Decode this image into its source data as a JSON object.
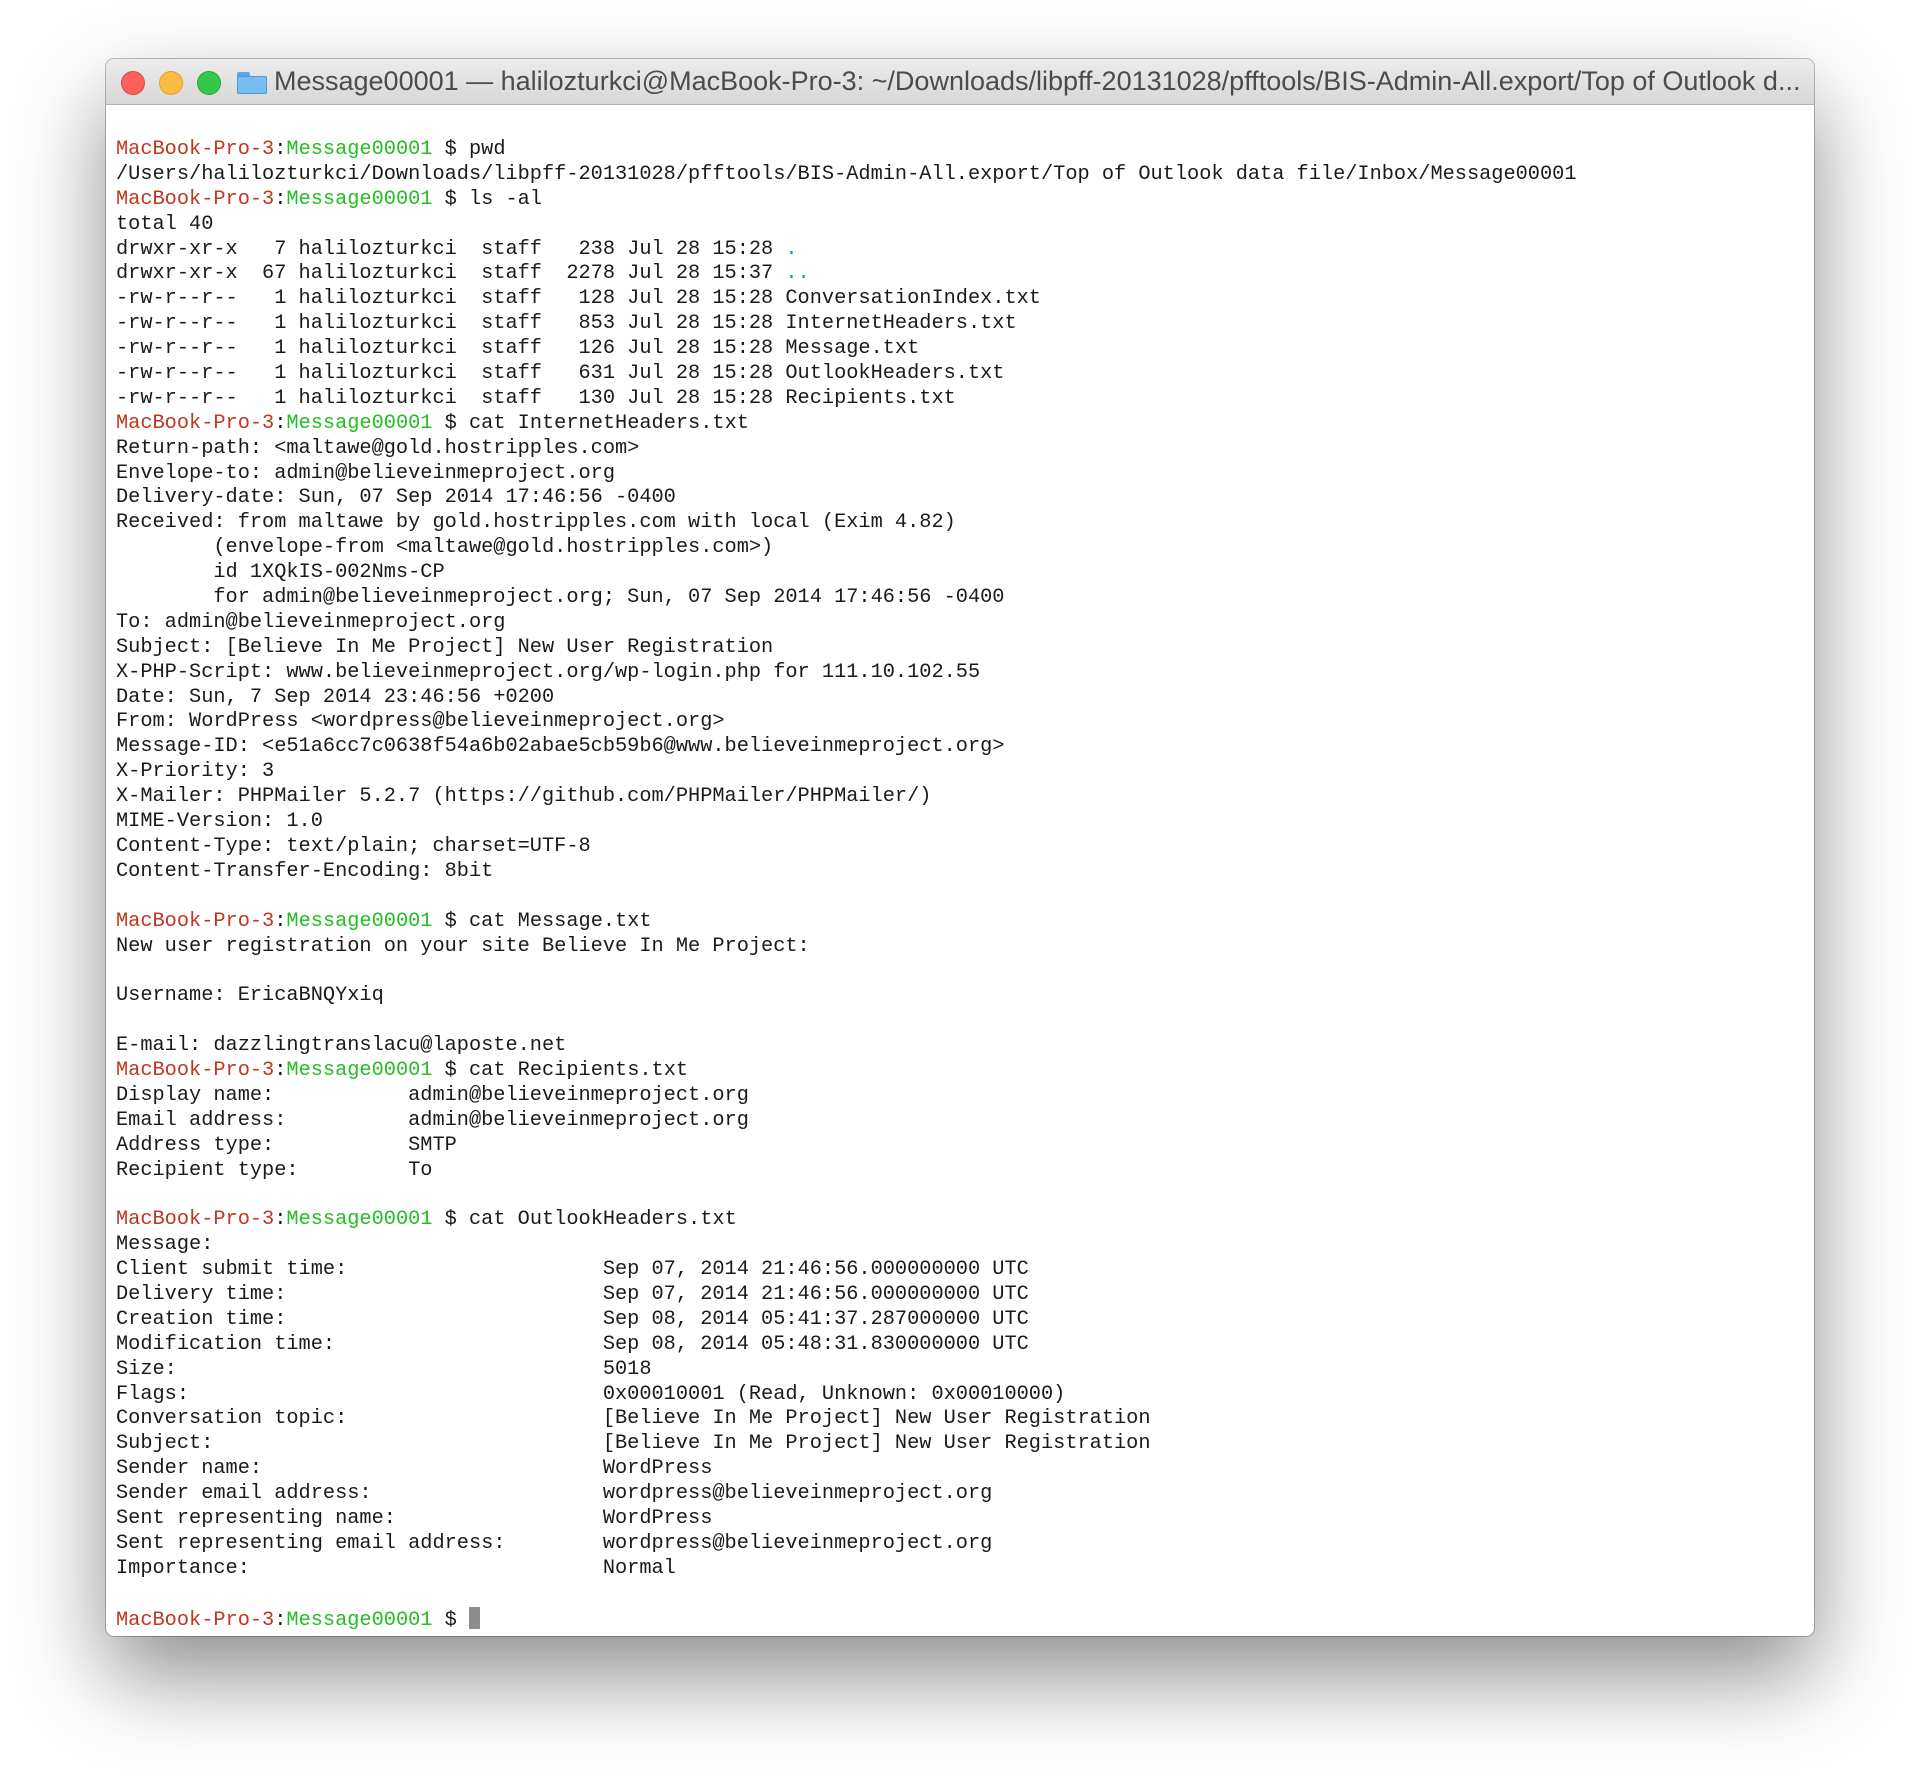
{
  "window": {
    "title": "Message00001 — halilozturkci@MacBook-Pro-3: ~/Downloads/libpff-20131028/pfftools/BIS-Admin-All.export/Top of Outlook d..."
  },
  "prompt": {
    "host": "MacBook-Pro-3",
    "sep": ":",
    "dir": "Message00001",
    "symbol": " $ "
  },
  "lines": [
    {
      "type": "cmd",
      "text": "pwd"
    },
    {
      "type": "out",
      "text": "/Users/halilozturkci/Downloads/libpff-20131028/pfftools/BIS-Admin-All.export/Top of Outlook data file/Inbox/Message00001"
    },
    {
      "type": "cmd",
      "text": "ls -al"
    },
    {
      "type": "out",
      "text": "total 40"
    },
    {
      "type": "ls",
      "text": "drwxr-xr-x   7 halilozturkci  staff   238 Jul 28 15:28 ",
      "name": "."
    },
    {
      "type": "ls",
      "text": "drwxr-xr-x  67 halilozturkci  staff  2278 Jul 28 15:37 ",
      "name": ".."
    },
    {
      "type": "out",
      "text": "-rw-r--r--   1 halilozturkci  staff   128 Jul 28 15:28 ConversationIndex.txt"
    },
    {
      "type": "out",
      "text": "-rw-r--r--   1 halilozturkci  staff   853 Jul 28 15:28 InternetHeaders.txt"
    },
    {
      "type": "out",
      "text": "-rw-r--r--   1 halilozturkci  staff   126 Jul 28 15:28 Message.txt"
    },
    {
      "type": "out",
      "text": "-rw-r--r--   1 halilozturkci  staff   631 Jul 28 15:28 OutlookHeaders.txt"
    },
    {
      "type": "out",
      "text": "-rw-r--r--   1 halilozturkci  staff   130 Jul 28 15:28 Recipients.txt"
    },
    {
      "type": "cmd",
      "text": "cat InternetHeaders.txt"
    },
    {
      "type": "out",
      "text": "Return-path: <maltawe@gold.hostripples.com>"
    },
    {
      "type": "out",
      "text": "Envelope-to: admin@believeinmeproject.org"
    },
    {
      "type": "out",
      "text": "Delivery-date: Sun, 07 Sep 2014 17:46:56 -0400"
    },
    {
      "type": "out",
      "text": "Received: from maltawe by gold.hostripples.com with local (Exim 4.82)"
    },
    {
      "type": "out",
      "text": "        (envelope-from <maltawe@gold.hostripples.com>)"
    },
    {
      "type": "out",
      "text": "        id 1XQkIS-002Nms-CP"
    },
    {
      "type": "out",
      "text": "        for admin@believeinmeproject.org; Sun, 07 Sep 2014 17:46:56 -0400"
    },
    {
      "type": "out",
      "text": "To: admin@believeinmeproject.org"
    },
    {
      "type": "out",
      "text": "Subject: [Believe In Me Project] New User Registration"
    },
    {
      "type": "out",
      "text": "X-PHP-Script: www.believeinmeproject.org/wp-login.php for 111.10.102.55"
    },
    {
      "type": "out",
      "text": "Date: Sun, 7 Sep 2014 23:46:56 +0200"
    },
    {
      "type": "out",
      "text": "From: WordPress <wordpress@believeinmeproject.org>"
    },
    {
      "type": "out",
      "text": "Message-ID: <e51a6cc7c0638f54a6b02abae5cb59b6@www.believeinmeproject.org>"
    },
    {
      "type": "out",
      "text": "X-Priority: 3"
    },
    {
      "type": "out",
      "text": "X-Mailer: PHPMailer 5.2.7 (https://github.com/PHPMailer/PHPMailer/)"
    },
    {
      "type": "out",
      "text": "MIME-Version: 1.0"
    },
    {
      "type": "out",
      "text": "Content-Type: text/plain; charset=UTF-8"
    },
    {
      "type": "out",
      "text": "Content-Transfer-Encoding: 8bit"
    },
    {
      "type": "out",
      "text": ""
    },
    {
      "type": "cmd",
      "text": "cat Message.txt"
    },
    {
      "type": "out",
      "text": "New user registration on your site Believe In Me Project:"
    },
    {
      "type": "out",
      "text": ""
    },
    {
      "type": "out",
      "text": "Username: EricaBNQYxiq"
    },
    {
      "type": "out",
      "text": ""
    },
    {
      "type": "out",
      "text": "E-mail: dazzlingtranslacu@laposte.net"
    },
    {
      "type": "cmd",
      "text": "cat Recipients.txt"
    },
    {
      "type": "out",
      "text": "Display name:           admin@believeinmeproject.org"
    },
    {
      "type": "out",
      "text": "Email address:          admin@believeinmeproject.org"
    },
    {
      "type": "out",
      "text": "Address type:           SMTP"
    },
    {
      "type": "out",
      "text": "Recipient type:         To"
    },
    {
      "type": "out",
      "text": ""
    },
    {
      "type": "cmd",
      "text": "cat OutlookHeaders.txt"
    },
    {
      "type": "out",
      "text": "Message:"
    },
    {
      "type": "out",
      "text": "Client submit time:                     Sep 07, 2014 21:46:56.000000000 UTC"
    },
    {
      "type": "out",
      "text": "Delivery time:                          Sep 07, 2014 21:46:56.000000000 UTC"
    },
    {
      "type": "out",
      "text": "Creation time:                          Sep 08, 2014 05:41:37.287000000 UTC"
    },
    {
      "type": "out",
      "text": "Modification time:                      Sep 08, 2014 05:48:31.830000000 UTC"
    },
    {
      "type": "out",
      "text": "Size:                                   5018"
    },
    {
      "type": "out",
      "text": "Flags:                                  0x00010001 (Read, Unknown: 0x00010000)"
    },
    {
      "type": "out",
      "text": "Conversation topic:                     [Believe In Me Project] New User Registration"
    },
    {
      "type": "out",
      "text": "Subject:                                [Believe In Me Project] New User Registration"
    },
    {
      "type": "out",
      "text": "Sender name:                            WordPress"
    },
    {
      "type": "out",
      "text": "Sender email address:                   wordpress@believeinmeproject.org"
    },
    {
      "type": "out",
      "text": "Sent representing name:                 WordPress"
    },
    {
      "type": "out",
      "text": "Sent representing email address:        wordpress@believeinmeproject.org"
    },
    {
      "type": "out",
      "text": "Importance:                             Normal"
    },
    {
      "type": "out",
      "text": ""
    },
    {
      "type": "cursor",
      "text": ""
    }
  ],
  "colors": {
    "host": "#c23621",
    "dir": "#25bc24",
    "hidden_entry": "#2d8bd8",
    "close": "#fc605c",
    "minimize": "#fdbc40",
    "maximize": "#34c84a"
  },
  "icons": {
    "title_folder": "folder-icon"
  }
}
